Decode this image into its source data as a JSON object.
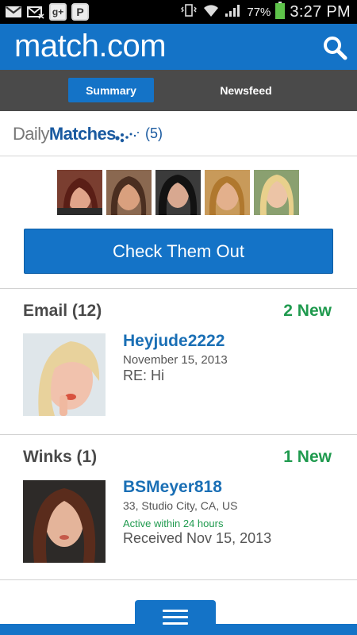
{
  "status_bar": {
    "icons_left": [
      "gmail-icon",
      "email-icon",
      "google-plus-icon",
      "pinterest-icon"
    ],
    "google_plus_label": "g+",
    "pinterest_label": "P",
    "battery_percent": "77%",
    "time": "3:27 PM"
  },
  "header": {
    "logo": "match.com"
  },
  "tabs": {
    "summary": "Summary",
    "newsfeed": "Newsfeed"
  },
  "daily_matches": {
    "brand_daily": "Daily",
    "brand_matches": "Matches",
    "count": "(5)",
    "cta_label": "Check Them Out"
  },
  "email": {
    "title": "Email (12)",
    "new_badge": "2 New",
    "item": {
      "name": "Heyjude2222",
      "date": "November 15, 2013",
      "subject": "RE: Hi"
    }
  },
  "winks": {
    "title": "Winks (1)",
    "new_badge": "1 New",
    "item": {
      "name": "BSMeyer818",
      "details": "33, Studio City, CA, US",
      "activity": "Active within 24 hours",
      "received": "Received Nov 15, 2013"
    }
  },
  "colors": {
    "brand_blue": "#1473c7",
    "tab_bar": "#4a4a4a",
    "new_green": "#1f9a4e",
    "name_blue": "#1a6fb5"
  }
}
